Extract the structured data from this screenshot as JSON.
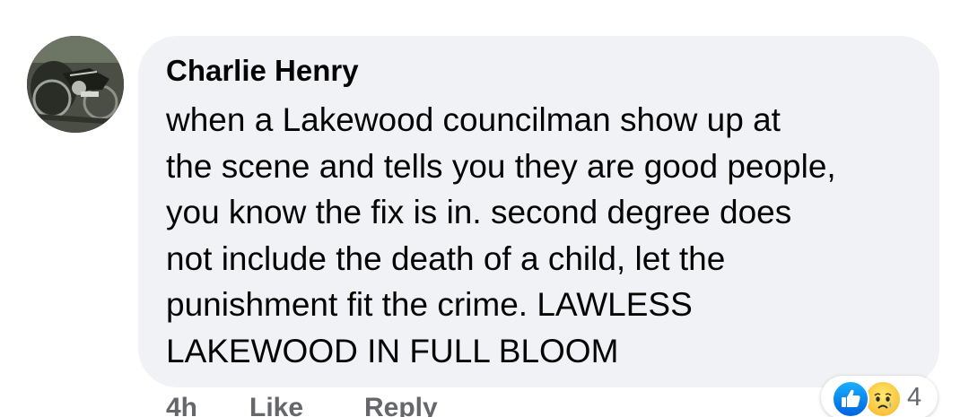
{
  "comment": {
    "author": "Charlie Henry",
    "text_lines": [
      "when a Lakewood councilman show up at",
      "the scene and tells you they are good people,",
      "you know the fix is in. second degree does",
      "not include the death of a child, let the",
      "punishment fit the crime. LAWLESS",
      "LAKEWOOD IN FULL BLOOM"
    ],
    "avatar_icon": "motorcycle-avatar"
  },
  "actions": {
    "timestamp": "4h",
    "like_label": "Like",
    "reply_label": "Reply"
  },
  "reactions": {
    "icons": [
      "like-icon",
      "sad-icon"
    ],
    "count": "4"
  },
  "colors": {
    "bubble": "#f0f2f5",
    "text": "#050505",
    "secondary_text": "#65676b",
    "like_blue": "#0866ff",
    "sad_yellow": "#f7b125"
  }
}
